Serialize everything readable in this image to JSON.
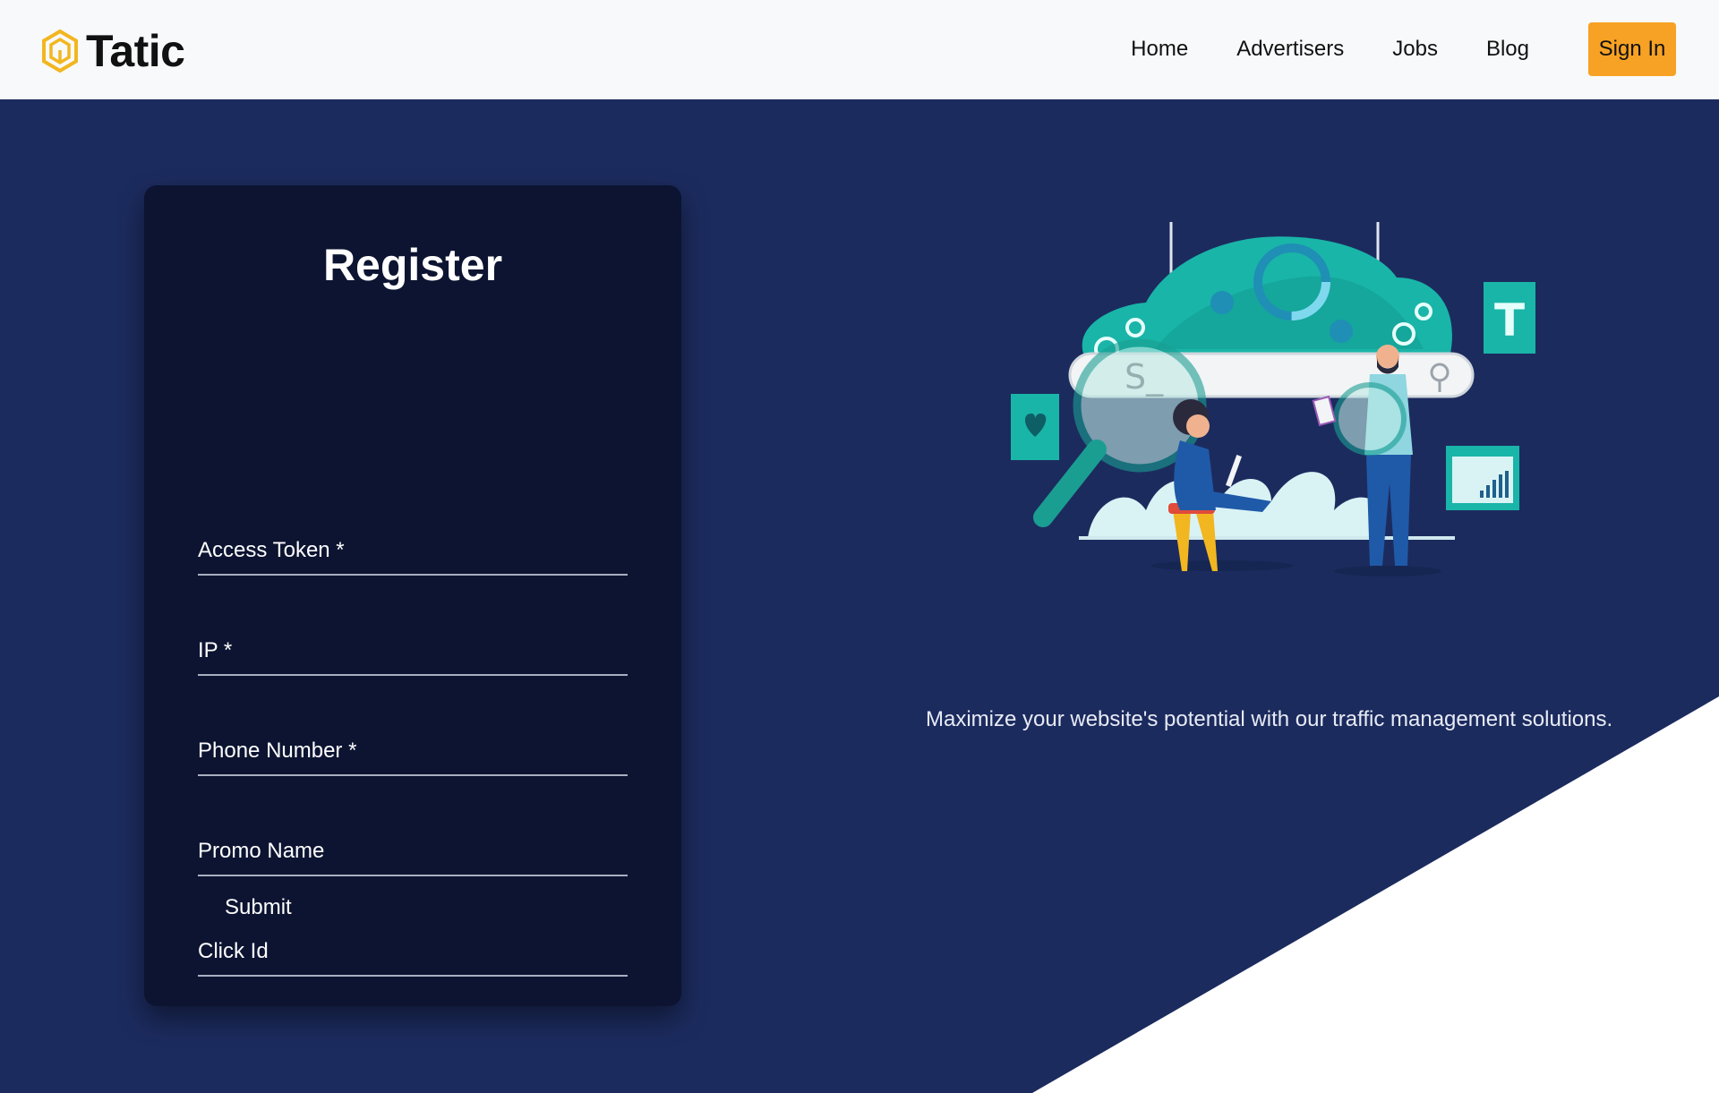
{
  "header": {
    "brand_name": "Tatic",
    "nav": [
      "Home",
      "Advertisers",
      "Jobs",
      "Blog"
    ],
    "signin_label": "Sign In"
  },
  "form": {
    "title": "Register",
    "fields": [
      {
        "label": "Access Token *"
      },
      {
        "label": "IP *"
      },
      {
        "label": "Phone Number *"
      },
      {
        "label": "Promo Name"
      },
      {
        "label": "Click Id"
      }
    ],
    "submit_label": "Submit"
  },
  "hero": {
    "tagline": "Maximize your website's potential with our traffic management solutions.",
    "illustration_search_text": "S_",
    "illustration_doc_letter": "T"
  },
  "colors": {
    "background": "#1c2b5e",
    "header": "#f8f9fa",
    "card": "#0c1431",
    "accent": "#f7a224",
    "logo": "#f2b620",
    "illustration_teal": "#19b5a8"
  },
  "icons": {
    "logo": "hexagon-logo-icon",
    "illustration": "search-analytics-illustration"
  }
}
